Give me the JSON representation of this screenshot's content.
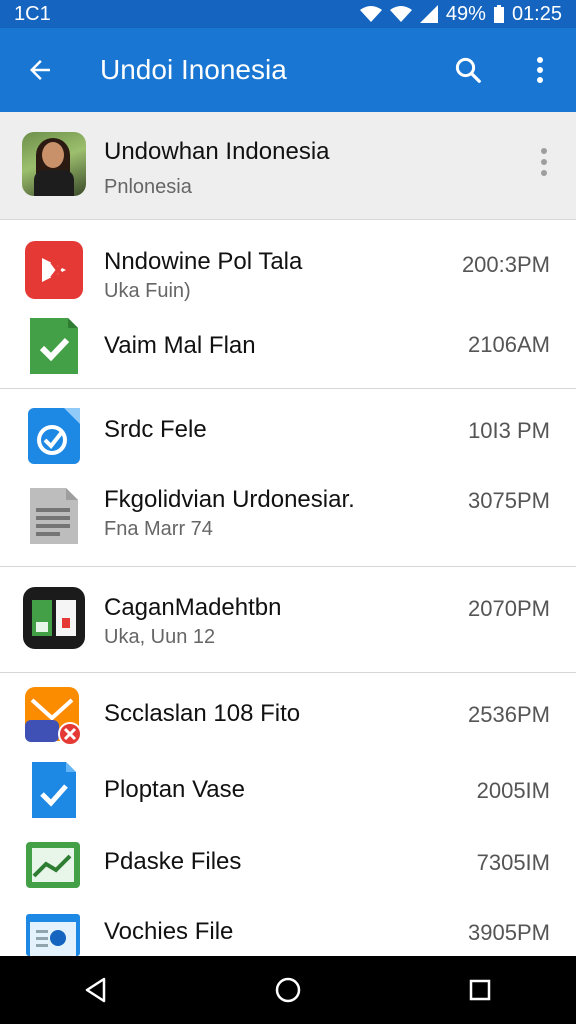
{
  "status_bar": {
    "left": "1C1",
    "battery": "49%",
    "time": "01:25"
  },
  "app_bar": {
    "title": "Undoi Inonesia"
  },
  "header": {
    "title": "Undowhan Indonesia",
    "subtitle": "Pnlonesia"
  },
  "files": [
    {
      "name": "Nndowine Pol Tala",
      "sub": "Uka Fuin)",
      "time": "200:3PM",
      "icon": "video-app-icon",
      "color": "#e53935"
    },
    {
      "name": "Vaim Mal Flan",
      "sub": "",
      "time": "2106AM",
      "icon": "green-doc-check-icon",
      "color": "#43a047"
    },
    {
      "name": "Srdc Fele",
      "sub": "",
      "time": "10I3 PM",
      "icon": "blue-doc-check-icon",
      "color": "#1e88e5"
    },
    {
      "name": "Fkgolidvian Urdonesiar.",
      "sub": "Fna Marr 74",
      "time": "3075PM",
      "icon": "gray-document-icon",
      "color": "#9e9e9e"
    },
    {
      "name": "CaganMadehtbn",
      "sub": "Uka, Uun 12",
      "time": "2070PM",
      "icon": "photo-app-icon",
      "color": "#1b1b1b"
    },
    {
      "name": "Scclaslan 108 Fito",
      "sub": "",
      "time": "2536PM",
      "icon": "mail-app-icon",
      "color": "#fb8c00"
    },
    {
      "name": "Ploptan Vase",
      "sub": "",
      "time": "2005IM",
      "icon": "blue-doc-check-icon",
      "color": "#1e88e5"
    },
    {
      "name": "Pdaske Files",
      "sub": "",
      "time": "7305IM",
      "icon": "chart-file-icon",
      "color": "#43a047"
    },
    {
      "name": "Vochies File",
      "sub": "",
      "time": "3905PM",
      "icon": "browser-file-icon",
      "color": "#1e88e5"
    }
  ]
}
